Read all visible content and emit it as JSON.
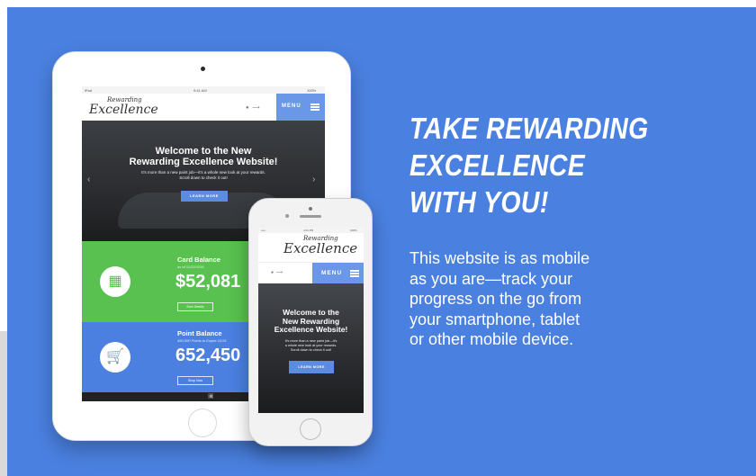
{
  "colors": {
    "banner": "#4a80e0",
    "green": "#58c14f",
    "blue_panel": "#4b7fe0",
    "menu": "#6b97e8"
  },
  "headline": {
    "line1": "TAKE REWARDING",
    "line2": "EXCELLENCE",
    "line3": "WITH YOU!"
  },
  "body": {
    "line1": "This website is as mobile",
    "line2": "as you are—track your",
    "line3": "progress on the go from",
    "line4": "your smartphone, tablet",
    "line5": "or other mobile device."
  },
  "tablet": {
    "status": {
      "left": "iPad",
      "center": "9:41 AM",
      "right": "100%"
    },
    "logo": {
      "line1": "Rewarding",
      "line2": "Excellence"
    },
    "menu_label": "MENU",
    "hero": {
      "title_line1": "Welcome to the New",
      "title_line2": "Rewarding Excellence Website!",
      "subtitle_line1": "It's more than a new paint job—it's a whole new look at your rewards.",
      "subtitle_line2": "Scroll down to check it out!",
      "button": "LEARN MORE"
    },
    "card_balance": {
      "title": "Card Balance",
      "subtitle": "as of 11/22/2016",
      "value": "$52,081",
      "button": "Earn Details"
    },
    "point_balance": {
      "title": "Point Balance",
      "subtitle": "450,000 Points to Expire 12/31",
      "value": "652,450",
      "button": "Shop Now"
    },
    "icons": {
      "card": "credit-card-icon",
      "cart": "shopping-cart-icon",
      "user": "user-icon",
      "logout": "logout-icon"
    }
  },
  "phone": {
    "status": {
      "left": "•••••",
      "center": "4:21 PM",
      "right": "100%"
    },
    "logo": {
      "line1": "Rewarding",
      "line2": "Excellence"
    },
    "menu_label": "MENU",
    "hero": {
      "title_line1": "Welcome to the",
      "title_line2": "New Rewarding",
      "title_line3": "Excellence Website!",
      "subtitle_line1": "It's more than a new paint job—it's",
      "subtitle_line2": "a whole new look at your rewards.",
      "subtitle_line3": "Scroll down to check it out!",
      "button": "LEARN MORE"
    }
  }
}
